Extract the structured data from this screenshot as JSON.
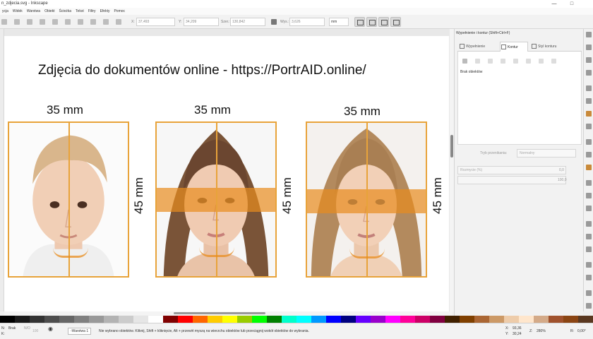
{
  "window": {
    "title": "n_zdjecia.svg - Inkscape",
    "minimize": "—",
    "maximize": "□"
  },
  "menu": [
    "ycja",
    "Widok",
    "Warstwa",
    "Obiekt",
    "Ścieżka",
    "Tekst",
    "Filtry",
    "Efekty",
    "Pomoc"
  ],
  "toolbar": {
    "x_label": "X:",
    "x_value": "37,493",
    "y_label": "Y:",
    "y_value": "34,209",
    "w_label": "Szer.:",
    "w_value": "130,842",
    "h_label": "Wys.:",
    "h_value": "3,626",
    "unit": "mm"
  },
  "canvas": {
    "heading": "Zdjęcia do dokumentów online - https://PortrAID.online/",
    "width_labels": [
      "35 mm",
      "35 mm",
      "35 mm"
    ],
    "height_labels": [
      "45 mm",
      "45 mm",
      "45 mm"
    ]
  },
  "dock": {
    "title": "Wypełnienie i kontur (Shift+Ctrl+F)",
    "tabs": [
      "Wypełnienie",
      "Kontur",
      "Styl konturu"
    ],
    "no_objects": "Brak obiektów",
    "blend_label": "Tryb przenikania:",
    "blend_value": "Normalny",
    "blur_label": "Rozmycie (%)",
    "blur_value": "0,0",
    "opacity_value": "100,0"
  },
  "statusbar": {
    "fill_label": "N:",
    "stroke_label": "K:",
    "stroke_value": "Brak",
    "opacity_label": "N/O",
    "opacity_value": "100",
    "layer": "-Warstwa 1",
    "message": "Nie wybrano obiektów. Kliknij, Shift + kliknięcie, Alt + przewiń myszą na wierzchu obiektów lub przeciągnij wokół obiektów do wybrania.",
    "x_label": "X:",
    "x_value": "93,36",
    "y_label": "Y:",
    "y_value": "30,24",
    "z_label": "Z:",
    "zoom": "280%",
    "r_label": "R:",
    "rotation": "0,00°"
  },
  "palette": [
    "#000000",
    "#1a1a1a",
    "#333333",
    "#4d4d4d",
    "#666666",
    "#808080",
    "#999999",
    "#b3b3b3",
    "#cccccc",
    "#e6e6e6",
    "#ffffff",
    "#800000",
    "#ff0000",
    "#ff6600",
    "#ffcc00",
    "#ffff00",
    "#99cc00",
    "#00ff00",
    "#008000",
    "#00ffcc",
    "#00ffff",
    "#0099ff",
    "#0000ff",
    "#000080",
    "#6600ff",
    "#9900cc",
    "#ff00ff",
    "#ff0099",
    "#cc0066",
    "#800040",
    "#402000",
    "#804000",
    "#aa6633",
    "#cc9966",
    "#eeccaa",
    "#ffe6cc",
    "#d4aa88",
    "#a0522d",
    "#8b4513",
    "#5a3820"
  ],
  "colors": {
    "accent_orange": "#e8a33a",
    "band_orange": "#e88c1e"
  }
}
